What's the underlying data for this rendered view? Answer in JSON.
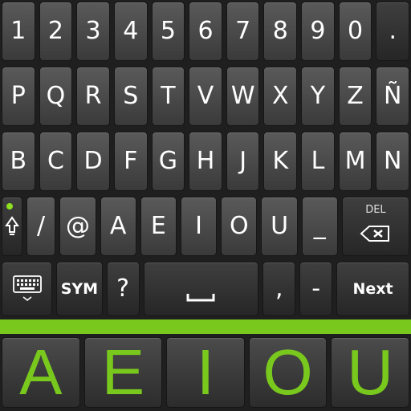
{
  "keyboard": {
    "row1": [
      "1",
      "2",
      "3",
      "4",
      "5",
      "6",
      "7",
      "8",
      "9",
      "0",
      "."
    ],
    "row2": [
      "P",
      "Q",
      "R",
      "S",
      "T",
      "V",
      "W",
      "X",
      "Y",
      "Z",
      "Ñ"
    ],
    "row3": [
      "B",
      "C",
      "D",
      "F",
      "G",
      "H",
      "J",
      "K",
      "L",
      "M",
      "N"
    ],
    "row4": [
      "/",
      "@",
      "A",
      "E",
      "I",
      "O",
      "U",
      "_"
    ],
    "row4_icons": {
      "shift": "shift-arrow-icon",
      "delete": "backspace-icon"
    },
    "delete_label": "DEL",
    "row5": {
      "keyboard_icon": "keyboard-hide-icon",
      "sym": "SYM",
      "question": "?",
      "space_icon": "space-bar-icon",
      "comma": ",",
      "dash": "-",
      "next": "Next"
    }
  },
  "banner": {
    "letters": [
      "A",
      "E",
      "I",
      "O",
      "U"
    ],
    "accent_color": "#79c81d"
  }
}
